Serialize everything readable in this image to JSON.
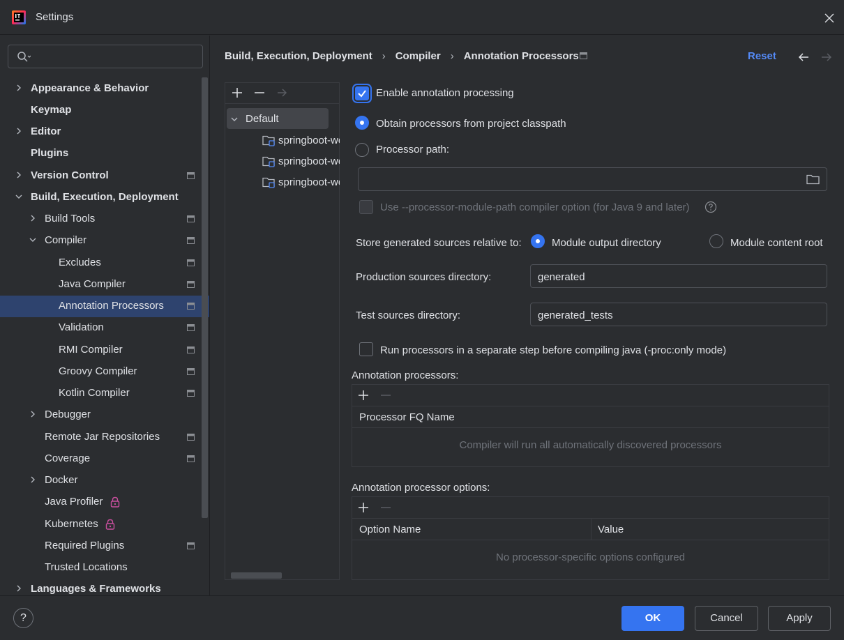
{
  "window": {
    "title": "Settings"
  },
  "search": {
    "placeholder": "",
    "value": ""
  },
  "sidebar": {
    "items": [
      {
        "label": "Appearance & Behavior",
        "bold": true,
        "expandable": true,
        "expanded": false
      },
      {
        "label": "Keymap",
        "bold": true
      },
      {
        "label": "Editor",
        "bold": true,
        "expandable": true,
        "expanded": false
      },
      {
        "label": "Plugins",
        "bold": true
      },
      {
        "label": "Version Control",
        "bold": true,
        "expandable": true,
        "expanded": false,
        "project_scoped": true
      },
      {
        "label": "Build, Execution, Deployment",
        "bold": true,
        "expandable": true,
        "expanded": true
      },
      {
        "label": "Build Tools",
        "expandable": true,
        "expanded": false,
        "project_scoped": true
      },
      {
        "label": "Compiler",
        "expandable": true,
        "expanded": true,
        "project_scoped": true
      },
      {
        "label": "Excludes",
        "project_scoped": true
      },
      {
        "label": "Java Compiler",
        "project_scoped": true
      },
      {
        "label": "Annotation Processors",
        "project_scoped": true,
        "selected": true
      },
      {
        "label": "Validation",
        "project_scoped": true
      },
      {
        "label": "RMI Compiler",
        "project_scoped": true
      },
      {
        "label": "Groovy Compiler",
        "project_scoped": true
      },
      {
        "label": "Kotlin Compiler",
        "project_scoped": true
      },
      {
        "label": "Debugger",
        "expandable": true,
        "expanded": false
      },
      {
        "label": "Remote Jar Repositories",
        "project_scoped": true
      },
      {
        "label": "Coverage",
        "project_scoped": true
      },
      {
        "label": "Docker",
        "expandable": true,
        "expanded": false
      },
      {
        "label": "Java Profiler",
        "locked": true
      },
      {
        "label": "Kubernetes",
        "locked": true
      },
      {
        "label": "Required Plugins",
        "project_scoped": true
      },
      {
        "label": "Trusted Locations"
      },
      {
        "label": "Languages & Frameworks",
        "bold": true,
        "expandable": true,
        "expanded": false
      }
    ]
  },
  "breadcrumb": {
    "items": [
      "Build, Execution, Deployment",
      "Compiler",
      "Annotation Processors"
    ],
    "separator": "›"
  },
  "header": {
    "reset_label": "Reset"
  },
  "profiles": {
    "default_label": "Default",
    "modules": [
      "springboot-web",
      "springboot-web",
      "springboot-web"
    ]
  },
  "settings": {
    "enable_label": "Enable annotation processing",
    "enable_checked": true,
    "obtain_label": "Obtain processors from project classpath",
    "processor_path_label": "Processor path:",
    "processor_path_value": "",
    "module_path_label": "Use --processor-module-path compiler option (for Java 9 and later)",
    "store_label": "Store generated sources relative to:",
    "module_output_label": "Module output directory",
    "module_content_label": "Module content root",
    "production_label": "Production sources directory:",
    "production_value": "generated",
    "test_label": "Test sources directory:",
    "test_value": "generated_tests",
    "separate_step_label": "Run processors in a separate step before compiling java (-proc:only mode)"
  },
  "processors_table": {
    "title": "Annotation processors:",
    "column": "Processor FQ Name",
    "empty_text": "Compiler will run all automatically discovered processors"
  },
  "options_table": {
    "title": "Annotation processor options:",
    "columns": [
      "Option Name",
      "Value"
    ],
    "empty_text": "No processor-specific options configured"
  },
  "footer": {
    "help_label": "?",
    "ok_label": "OK",
    "cancel_label": "Cancel",
    "apply_label": "Apply"
  },
  "colors": {
    "accent": "#3574f0",
    "link": "#548af7",
    "background": "#2b2d30",
    "selection": "#2e436e",
    "lock": "#c94f9e"
  }
}
